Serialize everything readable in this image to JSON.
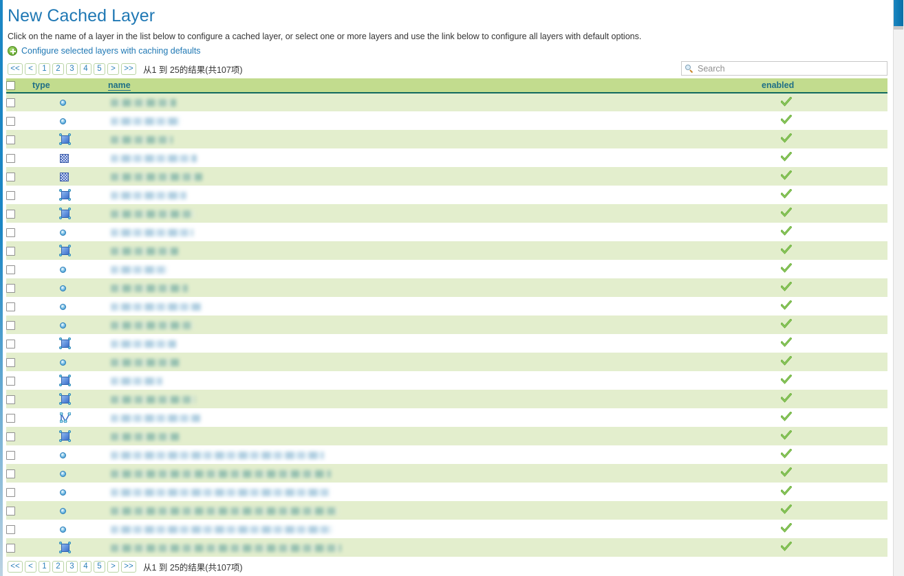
{
  "page": {
    "title": "New Cached Layer",
    "intro": "Click on the name of a layer in the list below to configure a cached layer, or select one or more layers and use the link below to configure all layers with default options.",
    "config_link": "Configure selected layers with caching defaults"
  },
  "colors": {
    "title_blue": "#1f78b4",
    "link_blue": "#1f78b4",
    "header_green": "#c2dc8e",
    "header_border": "#11695e",
    "row_alt": "#e3eecd",
    "check_green": "#5fa832",
    "pager_border": "#b9d4a4"
  },
  "pager": {
    "first_label": "<<",
    "prev_label": "<",
    "pages": [
      "1",
      "2",
      "3",
      "4",
      "5"
    ],
    "next_label": ">",
    "last_label": ">>",
    "results_text": "从1 到 25的结果(共107项)"
  },
  "search": {
    "placeholder": "Search",
    "value": "",
    "icon": "search-icon"
  },
  "table": {
    "columns": [
      {
        "key": "check",
        "label": ""
      },
      {
        "key": "type",
        "label": "type"
      },
      {
        "key": "name",
        "label": "name"
      },
      {
        "key": "enabled",
        "label": "enabled"
      }
    ],
    "select_all_checked": false,
    "rows": [
      {
        "type_icon": "point-icon",
        "name": "",
        "name_width": 95,
        "name_tone": "warm",
        "enabled": true
      },
      {
        "type_icon": "point-icon",
        "name": "",
        "name_width": 100,
        "name_tone": "cool",
        "enabled": true
      },
      {
        "type_icon": "polygon-icon",
        "name": "",
        "name_width": 90,
        "name_tone": "warm",
        "enabled": true
      },
      {
        "type_icon": "raster-icon",
        "name": "",
        "name_width": 125,
        "name_tone": "cool",
        "enabled": true
      },
      {
        "type_icon": "raster-icon",
        "name": "",
        "name_width": 133,
        "name_tone": "warm",
        "enabled": true
      },
      {
        "type_icon": "polygon-icon",
        "name": "",
        "name_width": 110,
        "name_tone": "cool",
        "enabled": true
      },
      {
        "type_icon": "polygon-icon",
        "name": "",
        "name_width": 122,
        "name_tone": "warm",
        "enabled": true
      },
      {
        "type_icon": "point-icon",
        "name": "",
        "name_width": 120,
        "name_tone": "cool",
        "enabled": true
      },
      {
        "type_icon": "polygon-icon",
        "name": "",
        "name_width": 98,
        "name_tone": "warm",
        "enabled": true
      },
      {
        "type_icon": "point-icon",
        "name": "",
        "name_width": 82,
        "name_tone": "cool",
        "enabled": true
      },
      {
        "type_icon": "point-icon",
        "name": "",
        "name_width": 112,
        "name_tone": "warm",
        "enabled": true
      },
      {
        "type_icon": "point-icon",
        "name": "",
        "name_width": 132,
        "name_tone": "cool",
        "enabled": true
      },
      {
        "type_icon": "point-icon",
        "name": "",
        "name_width": 120,
        "name_tone": "warm",
        "enabled": true
      },
      {
        "type_icon": "polygon-icon",
        "name": "",
        "name_width": 95,
        "name_tone": "cool",
        "enabled": true
      },
      {
        "type_icon": "point-icon",
        "name": "",
        "name_width": 100,
        "name_tone": "warm",
        "enabled": true
      },
      {
        "type_icon": "polygon-icon",
        "name": "",
        "name_width": 75,
        "name_tone": "cool",
        "enabled": true
      },
      {
        "type_icon": "polygon-icon",
        "name": "",
        "name_width": 123,
        "name_tone": "warm",
        "enabled": true
      },
      {
        "type_icon": "line-icon",
        "name": "",
        "name_width": 130,
        "name_tone": "cool",
        "enabled": true
      },
      {
        "type_icon": "polygon-icon",
        "name": "",
        "name_width": 100,
        "name_tone": "warm",
        "enabled": true
      },
      {
        "type_icon": "point-icon",
        "name": "",
        "name_width": 310,
        "name_tone": "cool",
        "enabled": true
      },
      {
        "type_icon": "point-icon",
        "name": "",
        "name_width": 320,
        "name_tone": "warm",
        "enabled": true
      },
      {
        "type_icon": "point-icon",
        "name": "",
        "name_width": 318,
        "name_tone": "cool",
        "enabled": true
      },
      {
        "type_icon": "point-icon",
        "name": "",
        "name_width": 330,
        "name_tone": "warm",
        "enabled": true
      },
      {
        "type_icon": "point-icon",
        "name": "",
        "name_width": 322,
        "name_tone": "cool",
        "enabled": true
      },
      {
        "type_icon": "polygon-icon",
        "name": "",
        "name_width": 335,
        "name_tone": "warm",
        "enabled": true
      }
    ]
  }
}
